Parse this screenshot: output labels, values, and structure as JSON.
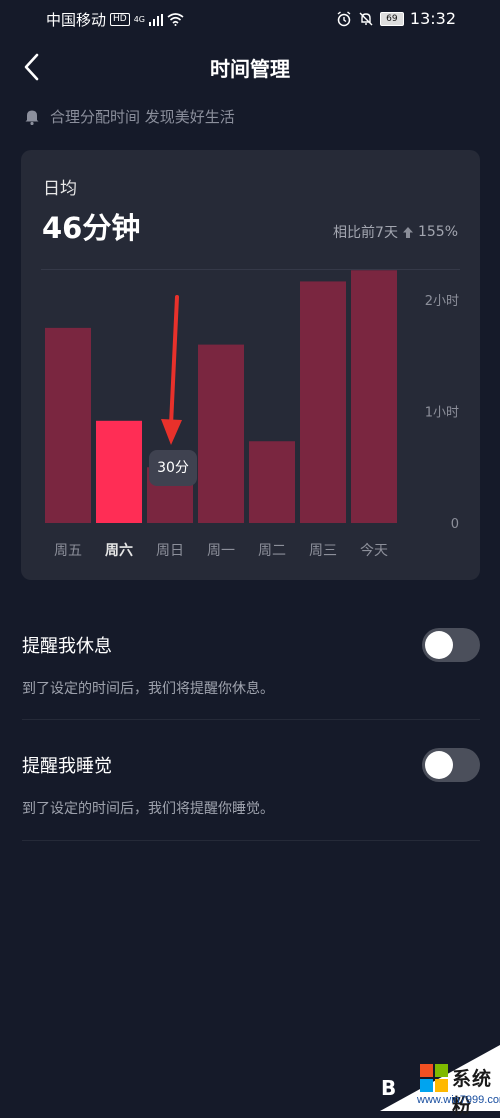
{
  "status_bar": {
    "carrier": "中国移动",
    "hd": "HD",
    "network": "4G",
    "battery": "69",
    "time": "13:32"
  },
  "header": {
    "title": "时间管理"
  },
  "notice": {
    "text": "合理分配时间 发现美好生活"
  },
  "summary": {
    "label": "日均",
    "value": "46分钟",
    "compare_text": "相比前7天",
    "compare_change": "155%"
  },
  "tooltip": {
    "text": "30分"
  },
  "chart_data": {
    "type": "bar",
    "categories": [
      "周五",
      "周六",
      "周日",
      "周一",
      "周二",
      "周三",
      "今天"
    ],
    "values": [
      105,
      55,
      30,
      96,
      44,
      130,
      136
    ],
    "unit": "minutes",
    "ylim": [
      0,
      120
    ],
    "yticks": [
      {
        "value": 0,
        "label": "0"
      },
      {
        "value": 60,
        "label": "1小时"
      },
      {
        "value": 120,
        "label": "2小时"
      }
    ],
    "highlight_index": 1,
    "selected_index": 2,
    "colors": {
      "bar": "#7a2640",
      "highlight": "#ff2d55",
      "tick_label": "#8c8f9a",
      "selected_label": "#e5e5e5"
    },
    "grid": false
  },
  "settings": [
    {
      "title": "提醒我休息",
      "desc": "到了设定的时间后，我们将提醒你休息。",
      "enabled": false
    },
    {
      "title": "提醒我睡觉",
      "desc": "到了设定的时间后，我们将提醒你睡觉。",
      "enabled": false
    }
  ],
  "watermark": {
    "partial": "B",
    "brand": "系统粉",
    "url": "www.win7999.com"
  }
}
